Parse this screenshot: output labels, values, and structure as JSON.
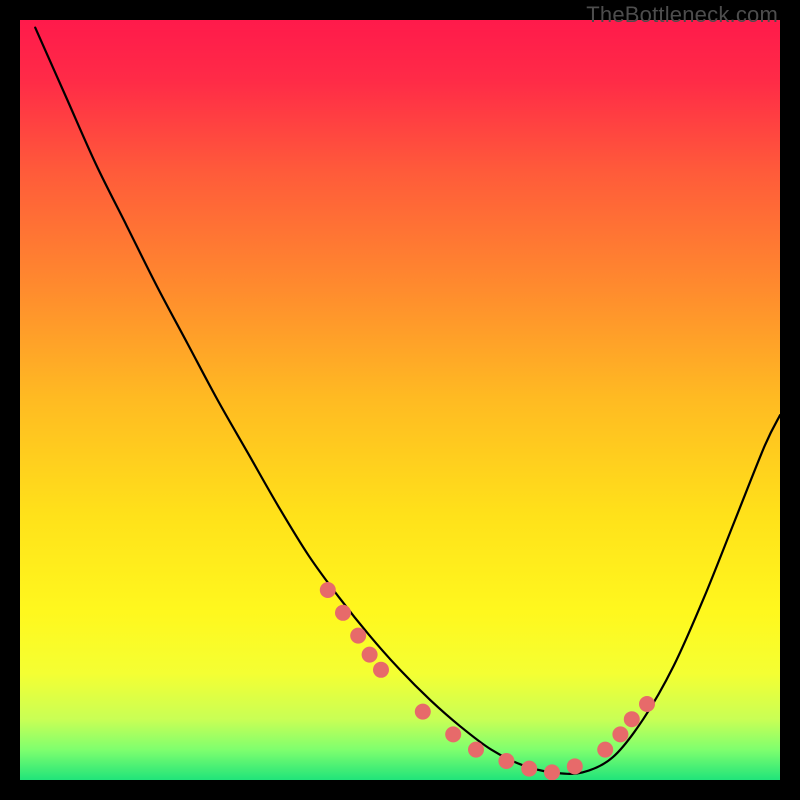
{
  "watermark": "TheBottleneck.com",
  "chart_data": {
    "type": "line",
    "title": "",
    "xlabel": "",
    "ylabel": "",
    "xlim": [
      0,
      100
    ],
    "ylim": [
      0,
      100
    ],
    "background_gradient": {
      "stops": [
        {
          "offset": 0.0,
          "color": "#ff1a4b"
        },
        {
          "offset": 0.08,
          "color": "#ff2b47"
        },
        {
          "offset": 0.2,
          "color": "#ff5b3a"
        },
        {
          "offset": 0.35,
          "color": "#ff8a2e"
        },
        {
          "offset": 0.5,
          "color": "#ffbb22"
        },
        {
          "offset": 0.65,
          "color": "#ffe11a"
        },
        {
          "offset": 0.78,
          "color": "#fff81e"
        },
        {
          "offset": 0.86,
          "color": "#f4ff33"
        },
        {
          "offset": 0.92,
          "color": "#c9ff55"
        },
        {
          "offset": 0.96,
          "color": "#7fff6e"
        },
        {
          "offset": 1.0,
          "color": "#20e47a"
        }
      ]
    },
    "series": [
      {
        "name": "bottleneck-curve",
        "color": "#000000",
        "x": [
          2,
          6,
          10,
          14,
          18,
          22,
          26,
          30,
          34,
          38,
          42,
          46,
          50,
          54,
          58,
          62,
          66,
          70,
          74,
          78,
          82,
          86,
          90,
          94,
          98,
          100
        ],
        "y": [
          99,
          90,
          81,
          73,
          65,
          57.5,
          50,
          43,
          36,
          29.5,
          24,
          19,
          14.5,
          10.5,
          7,
          4,
          2,
          1,
          1,
          3,
          8,
          15,
          24,
          34,
          44,
          48
        ]
      }
    ],
    "markers": {
      "name": "highlight-dots",
      "color": "#e76a6a",
      "radius": 8,
      "x": [
        40.5,
        42.5,
        44.5,
        46,
        47.5,
        53,
        57,
        60,
        64,
        67,
        70,
        73,
        77,
        79,
        80.5,
        82.5
      ],
      "y": [
        25,
        22,
        19,
        16.5,
        14.5,
        9,
        6,
        4,
        2.5,
        1.5,
        1,
        1.8,
        4,
        6,
        8,
        10
      ]
    }
  }
}
